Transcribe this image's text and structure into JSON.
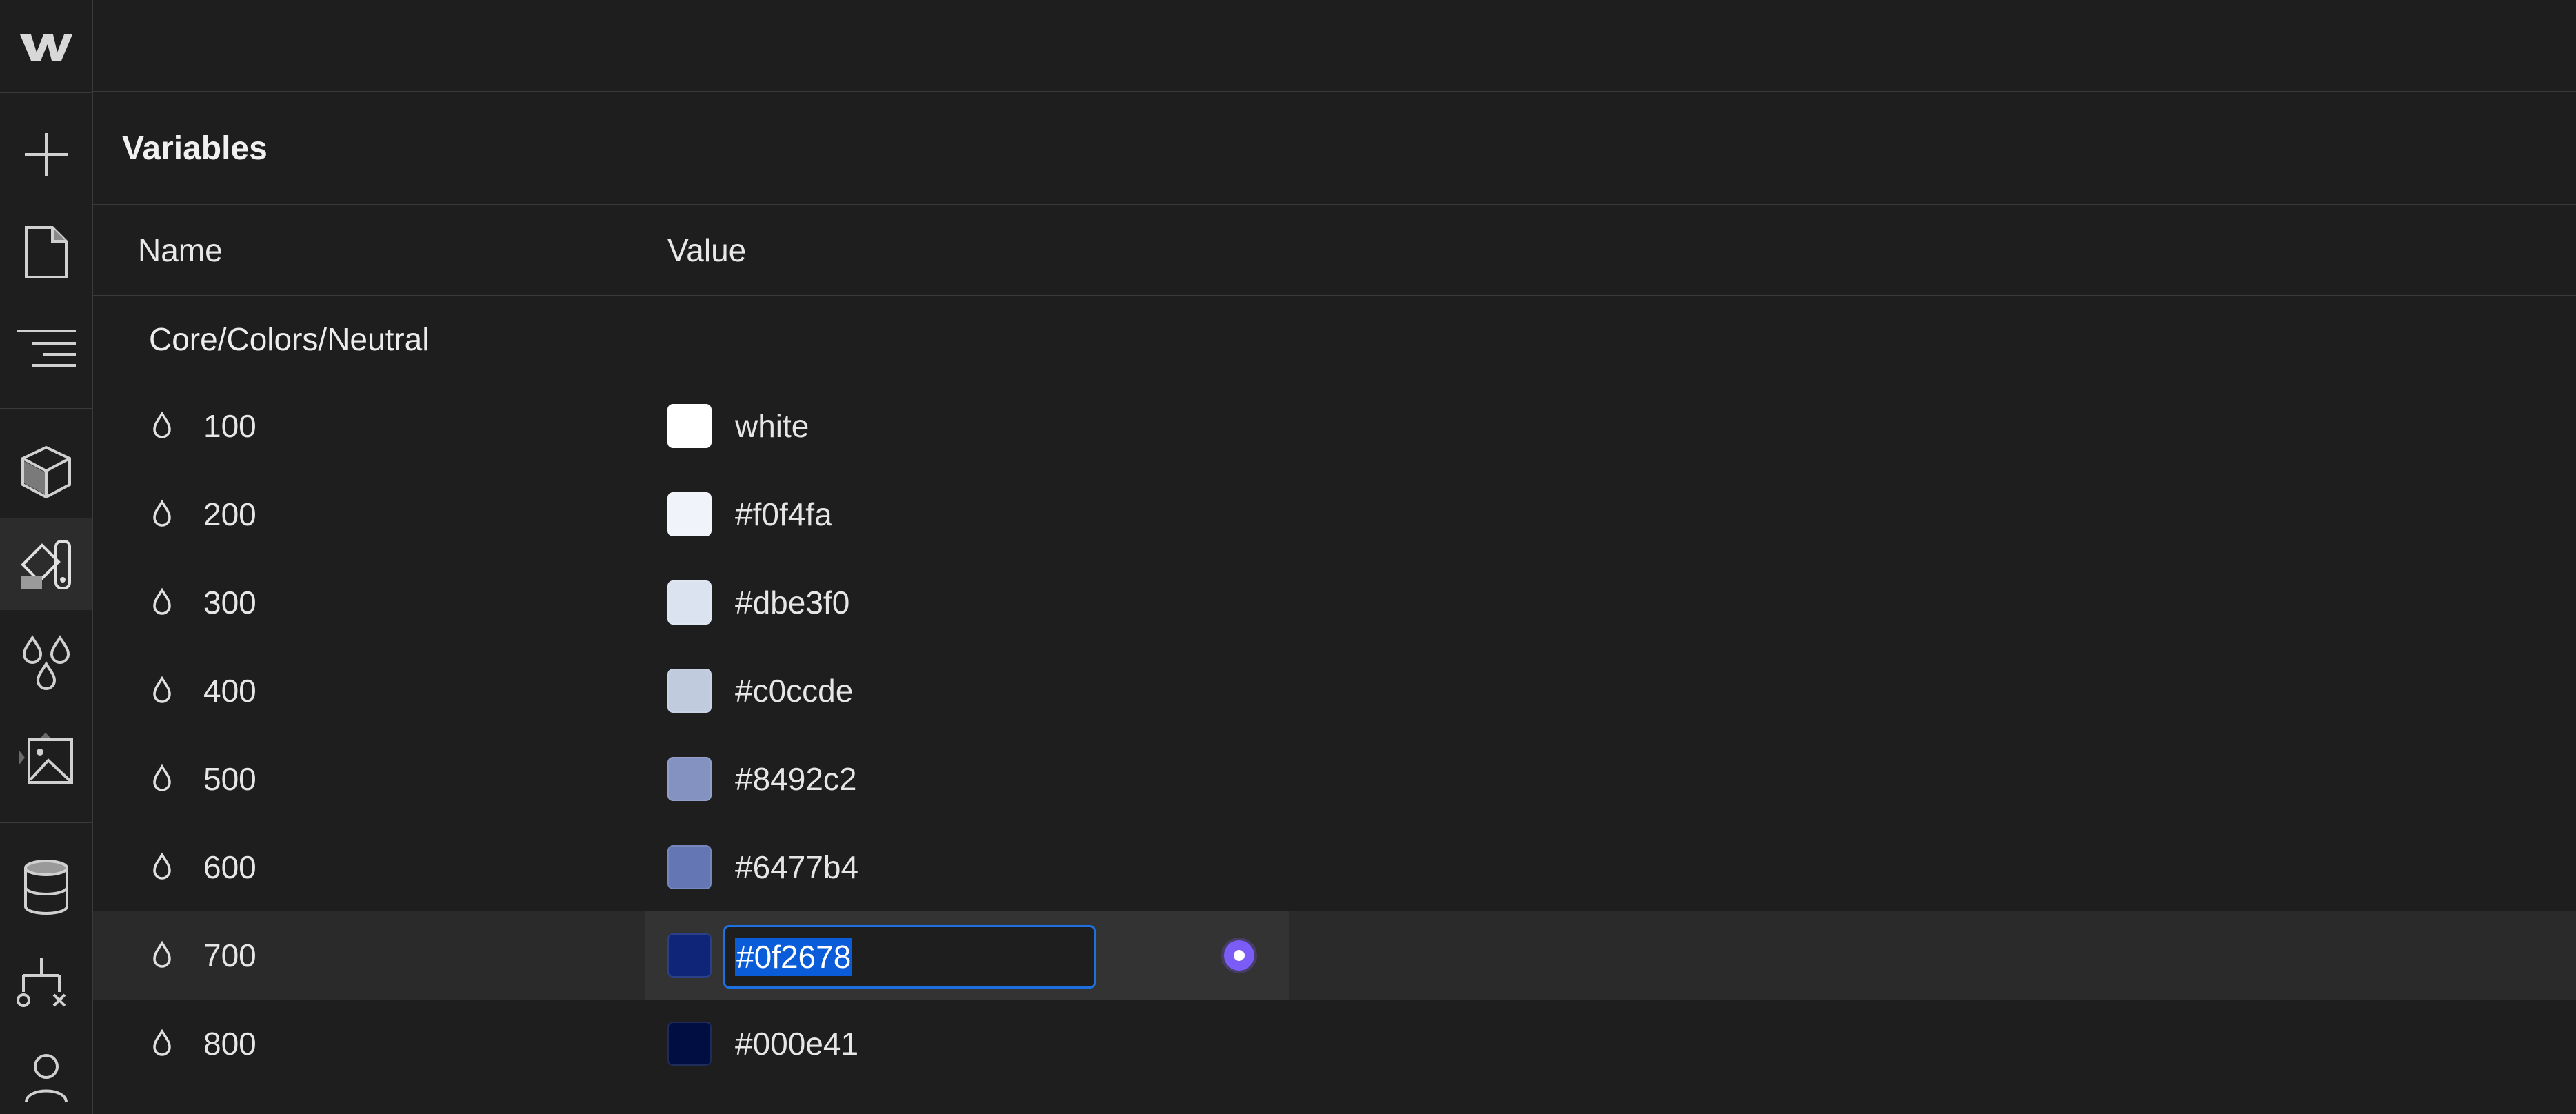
{
  "panel": {
    "title": "Variables",
    "columns": {
      "name": "Name",
      "value": "Value"
    },
    "group": "Core/Colors/Neutral"
  },
  "rail_icons": [
    "webflow-logo-icon",
    "add-icon",
    "pages-icon",
    "navigator-icon",
    "components-icon",
    "style-selector-icon",
    "variables-icon",
    "assets-icon",
    "cms-icon",
    "logic-icon",
    "users-icon"
  ],
  "active_rail_icon": "style-selector-icon",
  "rows": [
    {
      "name": "100",
      "value": "white",
      "swatch": "#ffffff"
    },
    {
      "name": "200",
      "value": "#f0f4fa",
      "swatch": "#f0f4fa"
    },
    {
      "name": "300",
      "value": "#dbe3f0",
      "swatch": "#dbe3f0"
    },
    {
      "name": "400",
      "value": "#c0ccde",
      "swatch": "#c0ccde"
    },
    {
      "name": "500",
      "value": "#8492c2",
      "swatch": "#8492c2"
    },
    {
      "name": "600",
      "value": "#6477b4",
      "swatch": "#6477b4"
    },
    {
      "name": "700",
      "value": "#0f2678",
      "swatch": "#0f2678",
      "editing": true
    },
    {
      "name": "800",
      "value": "#000e41",
      "swatch": "#000e41"
    }
  ]
}
